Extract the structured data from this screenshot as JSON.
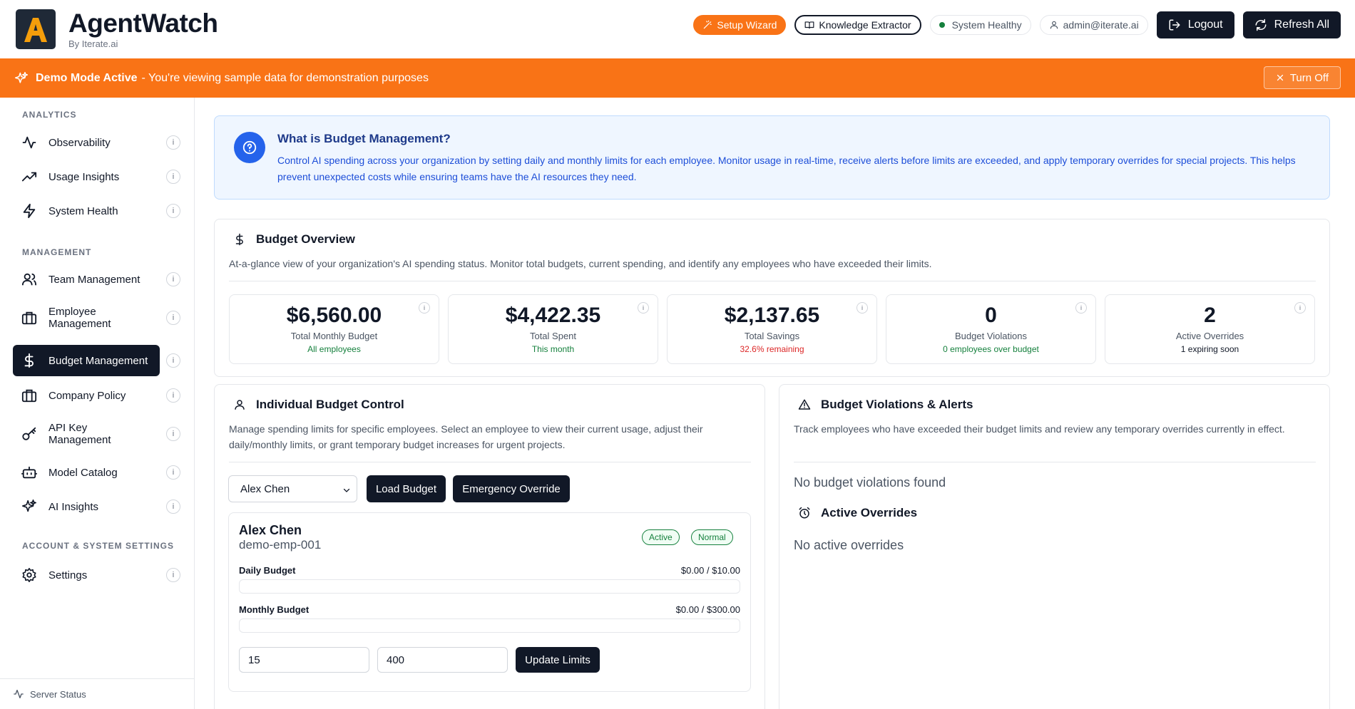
{
  "header": {
    "app_title": "AgentWatch",
    "app_subtitle": "By Iterate.ai",
    "setup_wizard": "Setup Wizard",
    "knowledge_extractor": "Knowledge Extractor",
    "system_status": "System Healthy",
    "user_email": "admin@iterate.ai",
    "logout": "Logout",
    "refresh_all": "Refresh All"
  },
  "banner": {
    "strong": "Demo Mode Active",
    "text": "- You're viewing sample data for demonstration purposes",
    "turn_off": "Turn Off"
  },
  "sidebar": {
    "sections": [
      "ANALYTICS",
      "MANAGEMENT",
      "ACCOUNT & SYSTEM SETTINGS"
    ],
    "items": [
      {
        "label": "Observability",
        "icon": "activity-icon"
      },
      {
        "label": "Usage Insights",
        "icon": "trending-up-icon"
      },
      {
        "label": "System Health",
        "icon": "zap-icon"
      },
      {
        "label": "Team Management",
        "icon": "users-icon"
      },
      {
        "label": "Employee Management",
        "icon": "briefcase-icon"
      },
      {
        "label": "Budget Management",
        "icon": "dollar-icon",
        "active": true
      },
      {
        "label": "Company Policy",
        "icon": "briefcase-icon"
      },
      {
        "label": "API Key Management",
        "icon": "key-icon"
      },
      {
        "label": "Model Catalog",
        "icon": "bot-icon"
      },
      {
        "label": "AI Insights",
        "icon": "sparkles-icon"
      },
      {
        "label": "Settings",
        "icon": "gear-icon"
      }
    ],
    "info_glyph": "i",
    "footer": "Server Status"
  },
  "info_card": {
    "title": "What is Budget Management?",
    "body": "Control AI spending across your organization by setting daily and monthly limits for each employee. Monitor usage in real-time, receive alerts before limits are exceeded, and apply temporary overrides for special projects. This helps prevent unexpected costs while ensuring teams have the AI resources they need."
  },
  "overview": {
    "title": "Budget Overview",
    "description": "At-a-glance view of your organization's AI spending status. Monitor total budgets, current spending, and identify any employees who have exceeded their limits.",
    "stats": [
      {
        "value": "$6,560.00",
        "label": "Total Monthly Budget",
        "sub": "All employees",
        "sub_color": "#15803d"
      },
      {
        "value": "$4,422.35",
        "label": "Total Spent",
        "sub": "This month",
        "sub_color": "#15803d"
      },
      {
        "value": "$2,137.65",
        "label": "Total Savings",
        "sub": "32.6% remaining",
        "sub_color": "#dc2626"
      },
      {
        "value": "0",
        "label": "Budget Violations",
        "sub": "0 employees over budget",
        "sub_color": "#15803d"
      },
      {
        "value": "2",
        "label": "Active Overrides",
        "sub": "1 expiring soon",
        "sub_color": "#111827"
      }
    ]
  },
  "individual": {
    "title": "Individual Budget Control",
    "description": "Manage spending limits for specific employees. Select an employee to view their current usage, adjust their daily/monthly limits, or grant temporary budget increases for urgent projects.",
    "selected_employee": "Alex Chen",
    "load_budget": "Load Budget",
    "emergency_override": "Emergency Override",
    "employee": {
      "name": "Alex Chen",
      "id": "demo-emp-001",
      "badge_status": "Active",
      "badge_level": "Normal",
      "daily_label": "Daily Budget",
      "daily_value": "$0.00 / $10.00",
      "daily_fraction": 0,
      "monthly_label": "Monthly Budget",
      "monthly_value": "$0.00 / $300.00",
      "monthly_fraction": 0,
      "daily_input": "15",
      "monthly_input": "400",
      "update_limits": "Update Limits"
    }
  },
  "violations": {
    "title": "Budget Violations & Alerts",
    "description": "Track employees who have exceeded their budget limits and review any temporary overrides currently in effect.",
    "empty": "No budget violations found",
    "overrides_title": "Active Overrides",
    "overrides_empty": "No active overrides"
  },
  "colors": {
    "accent": "#f97316",
    "dark": "#111827",
    "info_blue": "#2563eb",
    "success": "#15803d",
    "danger": "#dc2626"
  }
}
